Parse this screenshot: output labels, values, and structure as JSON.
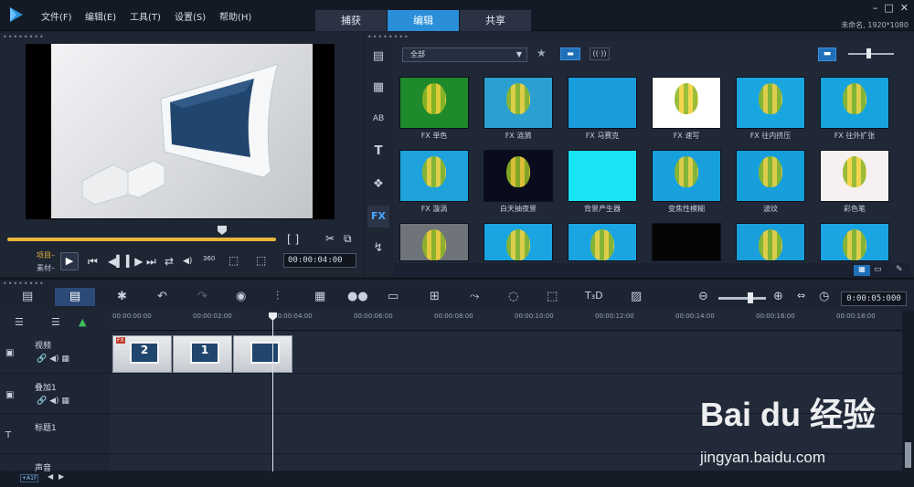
{
  "menu": {
    "file": "文件(F)",
    "edit": "编辑(E)",
    "tools": "工具(T)",
    "settings": "设置(S)",
    "help": "帮助(H)"
  },
  "tabs": {
    "capture": "捕获",
    "edit": "编辑",
    "share": "共享"
  },
  "window": {
    "minimize": "–",
    "maximize": "□",
    "close": "✕",
    "project_info": "未命名, 1920*1080"
  },
  "preview": {
    "grip": "••••••••",
    "mode_project": "项目–",
    "mode_clip": "素材–",
    "timecode": "00:00:04:00",
    "brackets": "[   ]",
    "volume_icon": "◀)",
    "res_label": "360"
  },
  "library": {
    "grip": "••••••••",
    "filter_value": "全部",
    "items": [
      {
        "label": "FX 单色",
        "bg": "#1f8a2c"
      },
      {
        "label": "FX 涟漪",
        "bg": "#2a9fd0"
      },
      {
        "label": "FX 马赛克",
        "bg": "#1a9ddc"
      },
      {
        "label": "FX 速写",
        "bg": "#ffffff"
      },
      {
        "label": "FX 往内挤压",
        "bg": "#19a6e0"
      },
      {
        "label": "FX 往外扩张",
        "bg": "#17a4de"
      },
      {
        "label": "FX 漩涡",
        "bg": "#1ea2dc"
      },
      {
        "label": "白天抽夜景",
        "bg": "#0b0b1e"
      },
      {
        "label": "背景产生器",
        "bg": "#18e4f4"
      },
      {
        "label": "变焦性模糊",
        "bg": "#17a0dc"
      },
      {
        "label": "波纹",
        "bg": "#169fdc"
      },
      {
        "label": "彩色笔",
        "bg": "#f6f1f0"
      },
      {
        "label": "",
        "bg": "#6f747a"
      },
      {
        "label": "",
        "bg": "#1aa5e2"
      },
      {
        "label": "",
        "bg": "#1aa5e2"
      },
      {
        "label": "",
        "bg": "#050505"
      },
      {
        "label": "",
        "bg": "#199fdb"
      },
      {
        "label": "",
        "bg": "#1aa5e2"
      }
    ]
  },
  "timeline": {
    "grip": "••••••••",
    "duration": "0:00:05:000",
    "ruler": [
      "00:00:00:00",
      "00:00:02:00",
      "00:00:04:00",
      "00:00:06:00",
      "00:00:08:00",
      "00:00:10:00",
      "00:00:12:00",
      "00:00:14:00",
      "00:00:16:00",
      "00:00:18:00"
    ],
    "tracks": [
      {
        "name": "视频",
        "icon": "▣"
      },
      {
        "name": "叠加1",
        "icon": "▣"
      },
      {
        "name": "标题1",
        "icon": "T"
      },
      {
        "name": "声音",
        "icon": "♪"
      }
    ],
    "clips": [
      {
        "num": "2",
        "fx": "FX"
      },
      {
        "num": "1",
        "fx": ""
      },
      {
        "num": "",
        "fx": ""
      }
    ]
  },
  "statusbar": {
    "label": "+A1F"
  },
  "watermark": {
    "brand": "Bai du 经验",
    "url": "jingyan.baidu.com"
  },
  "colors": {
    "accent": "#2a8fd8",
    "timeline_accent": "#e8b53b"
  }
}
